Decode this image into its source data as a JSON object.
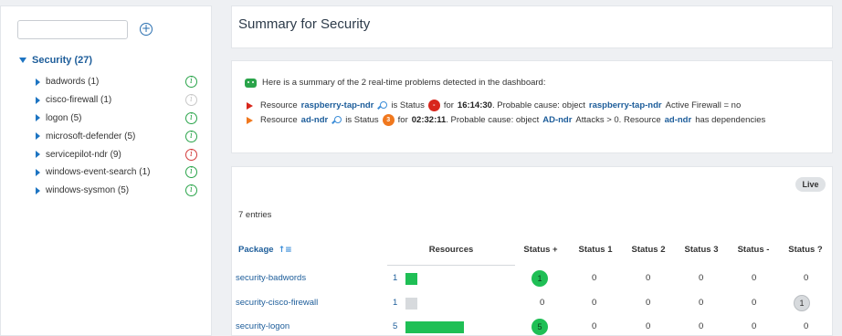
{
  "sidebar": {
    "search_placeholder": "",
    "root_label": "Security (27)",
    "items": [
      {
        "label": "badwords (1)",
        "status": "ok"
      },
      {
        "label": "cisco-firewall (1)",
        "status": "unknown"
      },
      {
        "label": "logon (5)",
        "status": "ok"
      },
      {
        "label": "microsoft-defender (5)",
        "status": "ok"
      },
      {
        "label": "servicepilot-ndr (9)",
        "status": "error"
      },
      {
        "label": "windows-event-search (1)",
        "status": "ok"
      },
      {
        "label": "windows-sysmon (5)",
        "status": "ok"
      }
    ]
  },
  "header": {
    "title": "Summary for Security"
  },
  "summary": {
    "intro": "Here is a summary of the 2 real-time problems detected in the dashboard:",
    "problems": [
      {
        "prefix": "Resource",
        "resource": "raspberry-tap-ndr",
        "is_status": "is Status",
        "badge": "-",
        "for": "for",
        "duration": "16:14:30",
        "cause_prefix": ". Probable cause: object",
        "object": "raspberry-tap-ndr",
        "cause_suffix": "Active Firewall = no",
        "extra_object": "",
        "extra_suffix": ""
      },
      {
        "prefix": "Resource",
        "resource": "ad-ndr",
        "is_status": "is Status",
        "badge": "3",
        "for": "for",
        "duration": "02:32:11",
        "cause_prefix": ". Probable cause: object",
        "object": "AD-ndr",
        "cause_suffix": "Attacks > 0. Resource",
        "extra_object": "ad-ndr",
        "extra_suffix": "has dependencies"
      }
    ]
  },
  "table": {
    "live_label": "Live",
    "entries_label": "7 entries",
    "sort_glyph": "↑≡",
    "columns": [
      "Package",
      "Resources",
      "Status +",
      "Status 1",
      "Status 2",
      "Status 3",
      "Status -",
      "Status ?"
    ],
    "rows": [
      {
        "package": "security-badwords",
        "resources": "1",
        "res_fraction": 0.2,
        "res_color": "#1fbf55",
        "s_plus": "1",
        "s1": "0",
        "s2": "0",
        "s3": "0",
        "s_minus": "0",
        "s_q": "0"
      },
      {
        "package": "security-cisco-firewall",
        "resources": "1",
        "res_fraction": 0.2,
        "res_color": "#d7dadd",
        "s_plus": "0",
        "s1": "0",
        "s2": "0",
        "s3": "0",
        "s_minus": "0",
        "s_q": "1"
      },
      {
        "package": "security-logon",
        "resources": "5",
        "res_fraction": 1.0,
        "res_color": "#1fbf55",
        "s_plus": "5",
        "s1": "0",
        "s2": "0",
        "s3": "0",
        "s_minus": "0",
        "s_q": "0"
      }
    ]
  }
}
